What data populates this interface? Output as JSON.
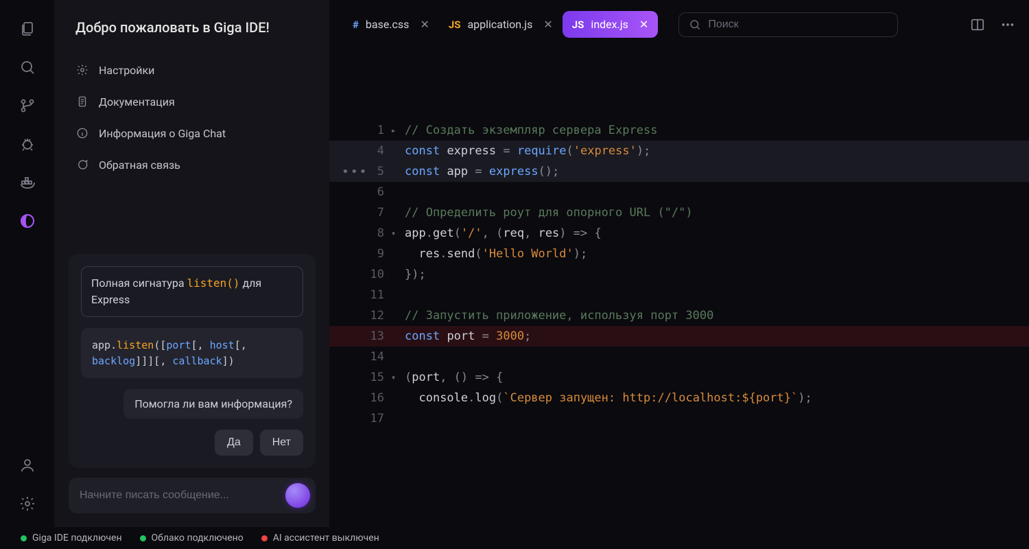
{
  "sidebar": {
    "title": "Добро пожаловать в Giga IDE!",
    "items": [
      {
        "label": "Настройки"
      },
      {
        "label": "Документация"
      },
      {
        "label": "Информация о Giga Chat"
      },
      {
        "label": "Обратная связь"
      }
    ]
  },
  "chat": {
    "question_prefix": "Полная сигнатура ",
    "question_code": "listen()",
    "question_suffix": " для Express",
    "code_html": "app.<span class='tok-fn'>listen</span>([<span class='tok-par'>port</span>[, <span class='tok-par'>host</span>[, <span class='tok-par'>backlog</span>]]][, <span class='tok-par'>callback</span>])",
    "followup": "Помогла ли вам информация?",
    "yes": "Да",
    "no": "Нет",
    "input_placeholder": "Начните писать сообщение..."
  },
  "tabs": [
    {
      "type": "css",
      "icon": "#",
      "name": "base.css",
      "active": false
    },
    {
      "type": "js",
      "icon": "JS",
      "name": "application.js",
      "active": false
    },
    {
      "type": "js",
      "icon": "JS",
      "name": "index.js",
      "active": true
    }
  ],
  "search_placeholder": "Поиск",
  "editor": {
    "lines": [
      {
        "n": 1,
        "fold": "▸",
        "cls": "",
        "html": "<span class='tok-comment'>// Создать экземпляр сервера Express</span>"
      },
      {
        "n": 4,
        "fold": "",
        "cls": "hl",
        "html": "<span class='tok-kw'>const</span> <span class='tok-var'>express</span> <span class='tok-op'>=</span> <span class='tok-call'>require</span><span class='tok-punc'>(</span><span class='tok-str'>'express'</span><span class='tok-punc'>);</span>"
      },
      {
        "n": 5,
        "fold": "",
        "cls": "hl",
        "ellipsis": true,
        "html": "<span class='tok-kw'>const</span> <span class='tok-var'>app</span> <span class='tok-op'>=</span> <span class='tok-call'>express</span><span class='tok-punc'>();</span>"
      },
      {
        "n": 6,
        "fold": "",
        "cls": "",
        "html": ""
      },
      {
        "n": 7,
        "fold": "",
        "cls": "",
        "html": "<span class='tok-comment'>// Определить роут для опорного URL (\"/\")</span>"
      },
      {
        "n": 8,
        "fold": "▾",
        "cls": "",
        "html": "<span class='tok-var'>app</span><span class='tok-punc'>.</span><span class='tok-var'>get</span><span class='tok-punc'>(</span><span class='tok-str'>'/'</span><span class='tok-punc'>, (</span><span class='tok-var'>req</span><span class='tok-punc'>, </span><span class='tok-var'>res</span><span class='tok-punc'>) =&gt; {</span>"
      },
      {
        "n": 9,
        "fold": "",
        "cls": "",
        "html": "  <span class='tok-var'>res</span><span class='tok-punc'>.</span><span class='tok-var'>send</span><span class='tok-punc'>(</span><span class='tok-str'>'Hello World'</span><span class='tok-punc'>);</span>"
      },
      {
        "n": 10,
        "fold": "",
        "cls": "",
        "html": "<span class='tok-punc'>});</span>"
      },
      {
        "n": 11,
        "fold": "",
        "cls": "",
        "html": ""
      },
      {
        "n": 12,
        "fold": "",
        "cls": "",
        "html": "<span class='tok-comment'>// Запустить приложение, используя порт 3000</span>"
      },
      {
        "n": 13,
        "fold": "",
        "cls": "hl-err",
        "html": "<span class='tok-kw'>const</span> <span class='tok-var'>port</span> <span class='tok-op'>=</span> <span class='tok-num'>3000</span><span class='tok-punc'>;</span>"
      },
      {
        "n": 14,
        "fold": "",
        "cls": "",
        "html": ""
      },
      {
        "n": 15,
        "fold": "▾",
        "cls": "",
        "html": "<span class='tok-punc'>(</span><span class='tok-var'>port</span><span class='tok-punc'>, () =&gt; {</span>"
      },
      {
        "n": 16,
        "fold": "",
        "cls": "",
        "html": "  <span class='tok-var'>console</span><span class='tok-punc'>.</span><span class='tok-var'>log</span><span class='tok-punc'>(</span><span class='tok-str'>`Сервер запущен: http://localhost:${port}`</span><span class='tok-punc'>);</span>"
      },
      {
        "n": 17,
        "fold": "",
        "cls": "",
        "html": ""
      }
    ]
  },
  "status": [
    {
      "color": "green",
      "label": "Giga IDE подключен"
    },
    {
      "color": "green",
      "label": "Облако подключено"
    },
    {
      "color": "red",
      "label": "AI ассистент выключен"
    }
  ]
}
